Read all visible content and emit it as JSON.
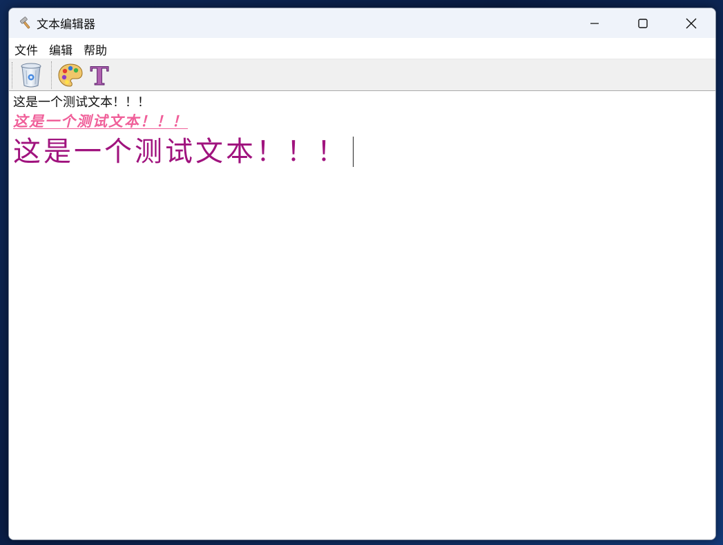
{
  "window": {
    "title": "文本编辑器",
    "app_icon": "hammer-icon",
    "controls": [
      "minimize-icon",
      "maximize-icon",
      "close-icon"
    ]
  },
  "menu": {
    "items": [
      {
        "label": "文件"
      },
      {
        "label": "编辑"
      },
      {
        "label": "帮助"
      }
    ]
  },
  "toolbar": {
    "buttons": [
      {
        "icon": "recycle-bin-icon"
      },
      {
        "icon": "color-palette-icon"
      },
      {
        "icon": "font-icon",
        "glyph": "T"
      }
    ]
  },
  "editor": {
    "lines": [
      {
        "text": "这是一个测试文本！！！",
        "color": "#111111"
      },
      {
        "text": "这是一个测试文本！！！",
        "color": "#f0609a"
      },
      {
        "text": "这是一个测试文本！！！",
        "color": "#a0137e"
      }
    ]
  }
}
